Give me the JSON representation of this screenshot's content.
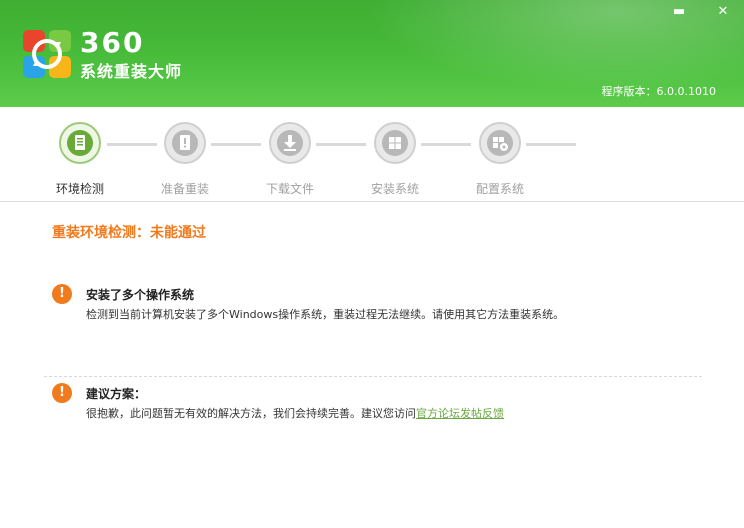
{
  "app": {
    "name": "360",
    "subtitle": "系统重装大师",
    "version_text": "程序版本：6.0.0.1010"
  },
  "window_controls": {
    "minimize_glyph": "▬",
    "close_glyph": "✕"
  },
  "steps": [
    {
      "label": "环境检测",
      "icon": "monitor-check-icon",
      "active": true
    },
    {
      "label": "准备重装",
      "icon": "warning-doc-icon",
      "active": false
    },
    {
      "label": "下载文件",
      "icon": "download-icon",
      "active": false
    },
    {
      "label": "安装系统",
      "icon": "windows-install-icon",
      "active": false
    },
    {
      "label": "配置系统",
      "icon": "windows-gear-icon",
      "active": false
    }
  ],
  "result": {
    "text": "重装环境检测：未能通过"
  },
  "issues": [
    {
      "icon": "warning-icon",
      "title": "安装了多个操作系统",
      "description": "检测到当前计算机安装了多个Windows操作系统，重装过程无法继续。请使用其它方法重装系统。"
    }
  ],
  "suggestion": {
    "icon": "warning-icon",
    "title": "建议方案：",
    "description": "很抱歉，此问题暂无有效的解决方法，我们会持续完善。建议您访问",
    "link_text": "官方论坛发帖反馈"
  },
  "colors": {
    "header_green": "#45b838",
    "accent_orange": "#f07a1e",
    "link_green": "#6aa840",
    "active_step_green": "#6aaa38"
  }
}
